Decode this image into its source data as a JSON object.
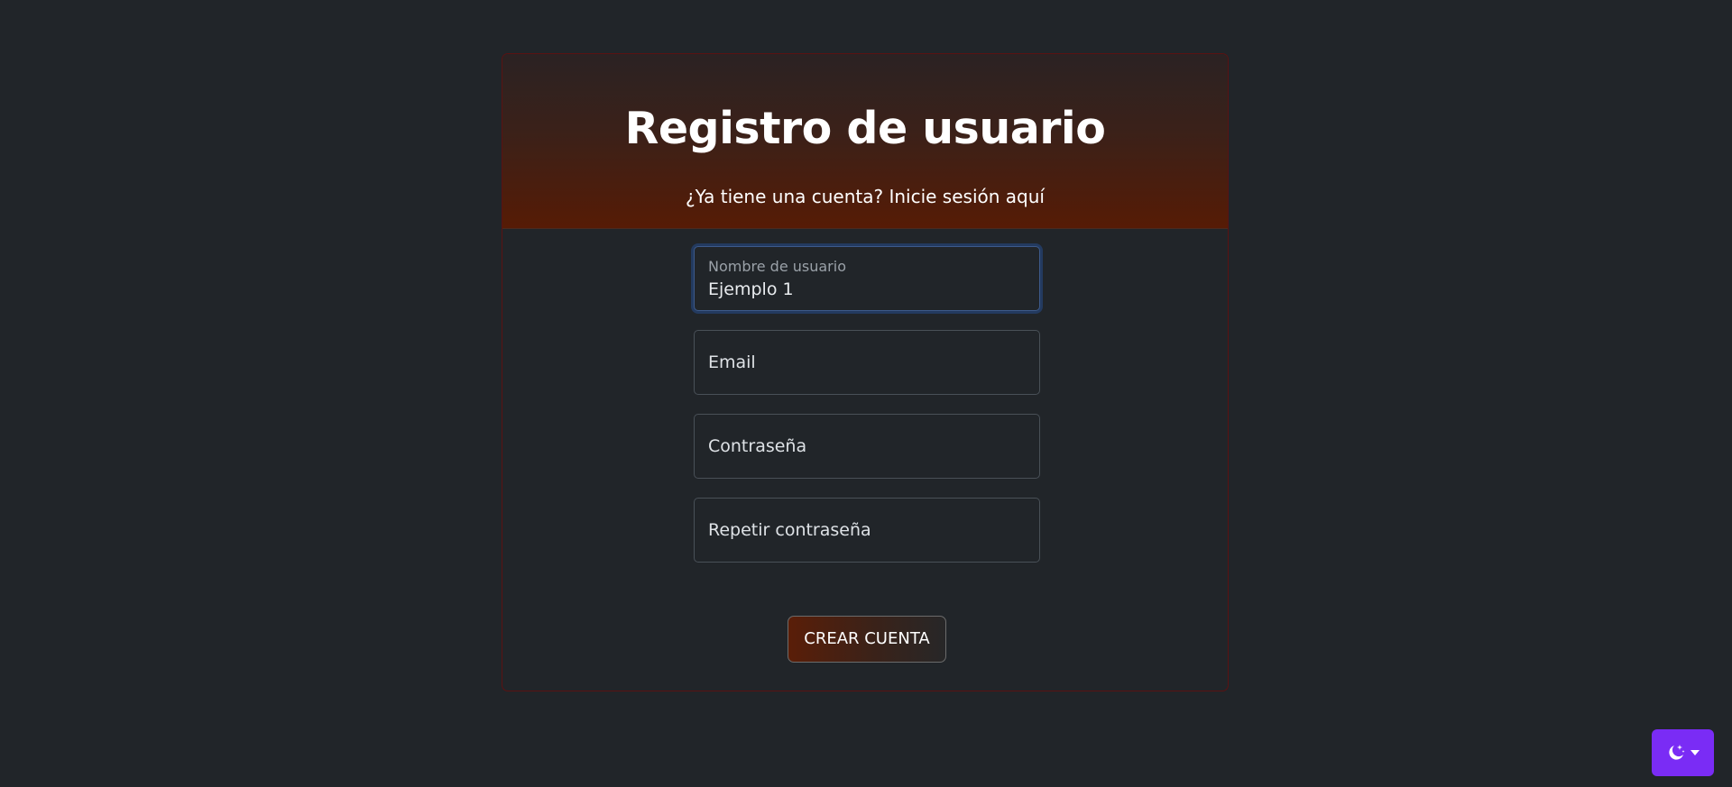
{
  "header": {
    "title": "Registro de usuario",
    "login_link": "¿Ya tiene una cuenta? Inicie sesión aquí"
  },
  "form": {
    "username": {
      "label": "Nombre de usuario",
      "value": "Ejemplo 1"
    },
    "email": {
      "placeholder": "Email"
    },
    "password": {
      "placeholder": "Contraseña"
    },
    "repeat_password": {
      "placeholder": "Repetir contraseña"
    },
    "submit_label": "CREAR CUENTA"
  },
  "theme_toggle": {
    "icon": "moon-stars-icon",
    "accent": "#7a2cf5"
  },
  "colors": {
    "background": "#212529",
    "header_gradient_bottom": "#561b05",
    "card_border": "#5a1212",
    "focus_ring": "#264c8c"
  }
}
